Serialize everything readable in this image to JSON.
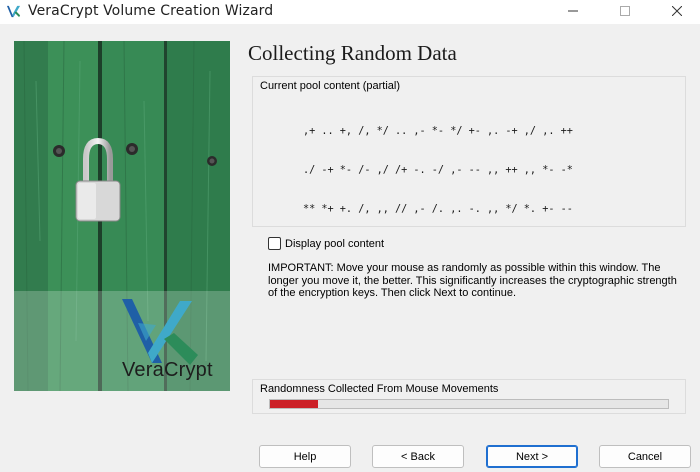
{
  "window": {
    "title": "VeraCrypt Volume Creation Wizard",
    "controls": [
      "minimize-icon",
      "maximize-icon",
      "close-icon"
    ]
  },
  "brand": {
    "logo_text": "VeraCrypt",
    "logo_colors": [
      "#1f5fa6",
      "#3fa9c9",
      "#2c8c5a"
    ]
  },
  "page": {
    "title": "Collecting Random Data",
    "pool_group_label": "Current pool content (partial)",
    "pool_lines": [
      ",+ .. +, /, */ .. ,- *- */ +- ,. -+ ,/ ,. ++",
      "./ -+ *- /- ,/ /+ -. -/ ,- -- ,, ++ ,, *- -*",
      "** *+ +. /, ,, // ,- /. ,. -. ,, */ *. +- --",
      "*/ .+ +/ -* *, +/ ,+ ,+ ,+ *+ ,/ ,- -+ -, *+",
      "., -/ .- ++ /. -+ ,- -, +- +- ++ /- ,+ .. -.",
      "-/ +, /* // // ,+ ** *. ,- +. -- -, +. -* ,+",
      "** -/ *, +, *. // +/ ,- // ,* .* +- ,- ./ ,,",
      ",- ,* *+ -. ., ,. +. ,- ,. ,- ., +- ,. ., .,"
    ],
    "display_pool_label": "Display pool content",
    "display_pool_checked": false,
    "important_text": "IMPORTANT: Move your mouse as randomly as possible within this window. The longer you move it, the better. This significantly increases the cryptographic strength of the encryption keys. Then click Next to continue.",
    "randomness_label": "Randomness Collected From Mouse Movements",
    "randomness_fraction": 0.12,
    "randomness_color": "#cc2027"
  },
  "buttons": {
    "help": "Help",
    "back": "< Back",
    "next": "Next >",
    "cancel": "Cancel"
  }
}
